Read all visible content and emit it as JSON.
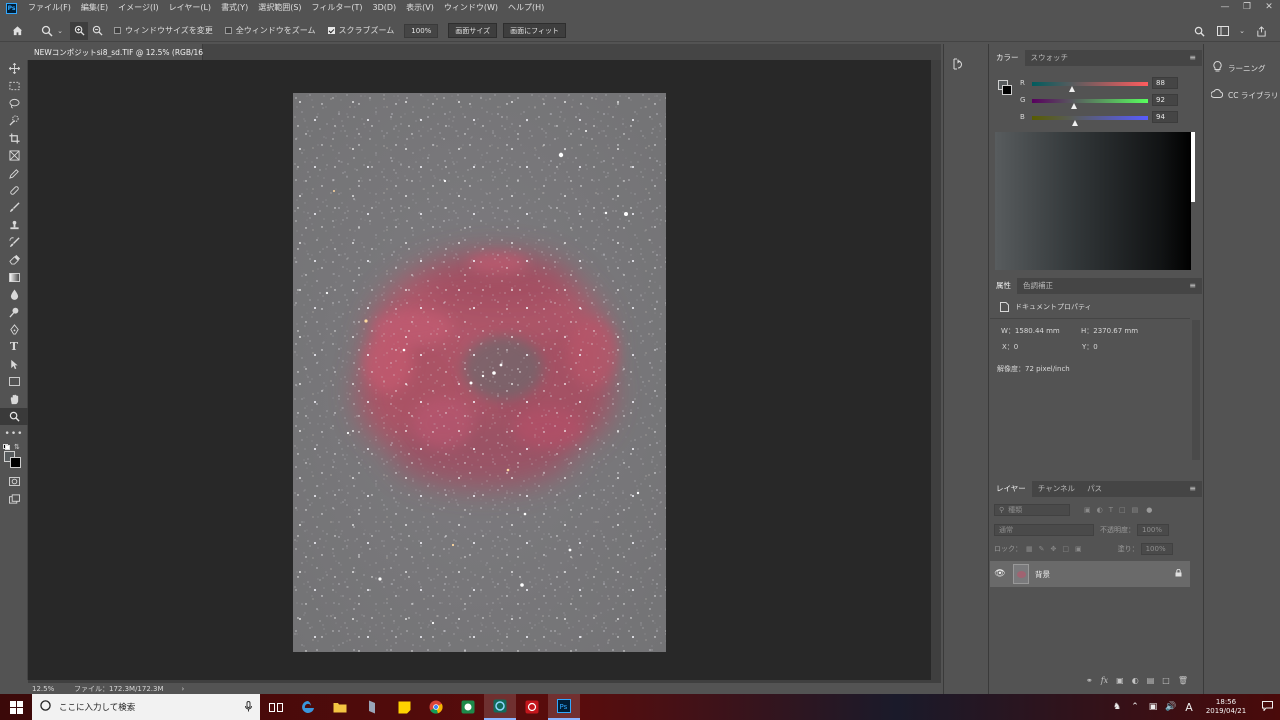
{
  "menubar": {
    "logo": "Ps",
    "items": [
      "ファイル(F)",
      "編集(E)",
      "イメージ(I)",
      "レイヤー(L)",
      "書式(Y)",
      "選択範囲(S)",
      "フィルター(T)",
      "3D(D)",
      "表示(V)",
      "ウィンドウ(W)",
      "ヘルプ(H)"
    ]
  },
  "options_bar": {
    "resize_windows_label": "ウィンドウサイズを変更",
    "resize_windows_checked": false,
    "zoom_all_windows_label": "全ウィンドウをズーム",
    "zoom_all_windows_checked": false,
    "scrubby_zoom_label": "スクラブズーム",
    "scrubby_zoom_checked": true,
    "zoom_value": "100%",
    "fit_canvas_button": "画面サイズ",
    "fill_screen_button": "画面にフィット"
  },
  "document": {
    "tab_title": "NEWコンポジットsi8_sd.TIF @ 12.5% (RGB/16)",
    "close_glyph": "×"
  },
  "status_bar": {
    "zoom": "12.5%",
    "file_info": "ファイル：172.3M/172.3M",
    "arrow": "›"
  },
  "color_panel": {
    "tabs": [
      "カラー",
      "スウォッチ"
    ],
    "active_tab": 0,
    "r_label": "R",
    "g_label": "G",
    "b_label": "B",
    "r": "88",
    "g": "92",
    "b": "94",
    "r_level": 0.345,
    "g_level": 0.361,
    "b_level": 0.369,
    "foreground_color": "#585c5e",
    "background_color": "#000000"
  },
  "properties_panel": {
    "tabs": [
      "属性",
      "色調補正"
    ],
    "active_tab": 0,
    "doc_props_label": "ドキュメントプロパティ",
    "w": "W：1580.44 mm",
    "h": "H：2370.67 mm",
    "x": "X：0",
    "y": "Y：0",
    "resolution": "解像度：72 pixel/inch"
  },
  "layers_panel": {
    "tabs": [
      "レイヤー",
      "チャンネル",
      "パス"
    ],
    "active_tab": 0,
    "kind_filter": "種類",
    "blend_mode": "通常",
    "opacity_label": "不透明度：",
    "opacity": "100%",
    "lock_label": "ロック：",
    "fill_label": "塗り：",
    "fill": "100%",
    "layer_name": "背景"
  },
  "learn_panel": {
    "items": [
      "ラーニング",
      "CC ライブラリ"
    ]
  },
  "taskbar": {
    "search_placeholder": "ここに入力して検索",
    "time": "18:56",
    "date": "2019/04/21",
    "ime": "A",
    "accent_color": "#5a0c0c"
  }
}
